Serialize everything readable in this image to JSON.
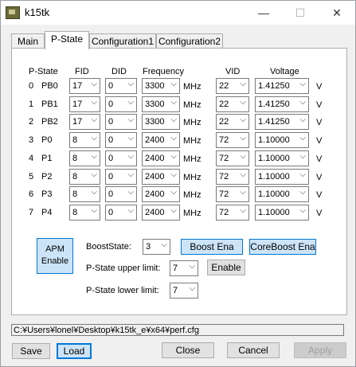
{
  "window": {
    "title": "k15tk",
    "minimize": "—",
    "maximize": "☐",
    "close": "✕"
  },
  "tabs": [
    "Main",
    "P-State",
    "Configuration1",
    "Configuration2"
  ],
  "headers": {
    "pstate": "P-State",
    "fid": "FID",
    "did": "DID",
    "frequency": "Frequency",
    "vid": "VID",
    "voltage": "Voltage"
  },
  "unit_mhz": "MHz",
  "unit_v": "V",
  "rows": [
    {
      "idx": "0",
      "name": "PB0",
      "fid": "17",
      "did": "0",
      "freq": "3300",
      "vid": "22",
      "volt": "1.41250"
    },
    {
      "idx": "1",
      "name": "PB1",
      "fid": "17",
      "did": "0",
      "freq": "3300",
      "vid": "22",
      "volt": "1.41250"
    },
    {
      "idx": "2",
      "name": "PB2",
      "fid": "17",
      "did": "0",
      "freq": "3300",
      "vid": "22",
      "volt": "1.41250"
    },
    {
      "idx": "3",
      "name": "P0",
      "fid": "8",
      "did": "0",
      "freq": "2400",
      "vid": "72",
      "volt": "1.10000"
    },
    {
      "idx": "4",
      "name": "P1",
      "fid": "8",
      "did": "0",
      "freq": "2400",
      "vid": "72",
      "volt": "1.10000"
    },
    {
      "idx": "5",
      "name": "P2",
      "fid": "8",
      "did": "0",
      "freq": "2400",
      "vid": "72",
      "volt": "1.10000"
    },
    {
      "idx": "6",
      "name": "P3",
      "fid": "8",
      "did": "0",
      "freq": "2400",
      "vid": "72",
      "volt": "1.10000"
    },
    {
      "idx": "7",
      "name": "P4",
      "fid": "8",
      "did": "0",
      "freq": "2400",
      "vid": "72",
      "volt": "1.10000"
    }
  ],
  "apm": {
    "line1": "APM",
    "line2": "Enable"
  },
  "boost": {
    "label": "BoostState:",
    "value": "3",
    "boost_ena": "Boost Ena",
    "coreboost_ena": "CoreBoost Ena",
    "upper_label": "P-State upper limit:",
    "upper_value": "7",
    "enable": "Enable",
    "lower_label": "P-State lower limit:",
    "lower_value": "7"
  },
  "path": "C:¥Users¥lonel¥Desktop¥k15tk_e¥x64¥perf.cfg",
  "footer": {
    "save": "Save",
    "load": "Load",
    "close": "Close",
    "cancel": "Cancel",
    "apply": "Apply"
  }
}
